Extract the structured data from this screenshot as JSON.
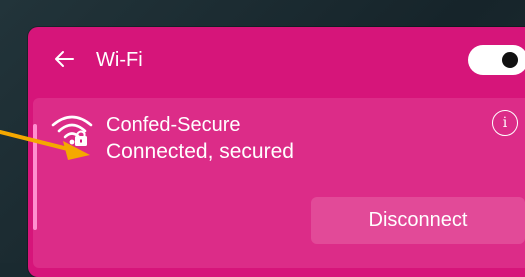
{
  "header": {
    "title": "Wi-Fi",
    "wifi_enabled": true
  },
  "network": {
    "name": "Confed-Secure",
    "status": "Connected, secured",
    "info_glyph": "i",
    "disconnect_label": "Disconnect"
  },
  "icons": {
    "back": "back-arrow-icon",
    "wifi": "wifi-secured-icon",
    "info": "info-icon",
    "annotation": "annotation-arrow"
  },
  "colors": {
    "panel": "#d6157a",
    "card": "#dc2c88",
    "button": "#e24a98",
    "annotation_arrow": "#f5a800",
    "text": "#ffffff"
  }
}
